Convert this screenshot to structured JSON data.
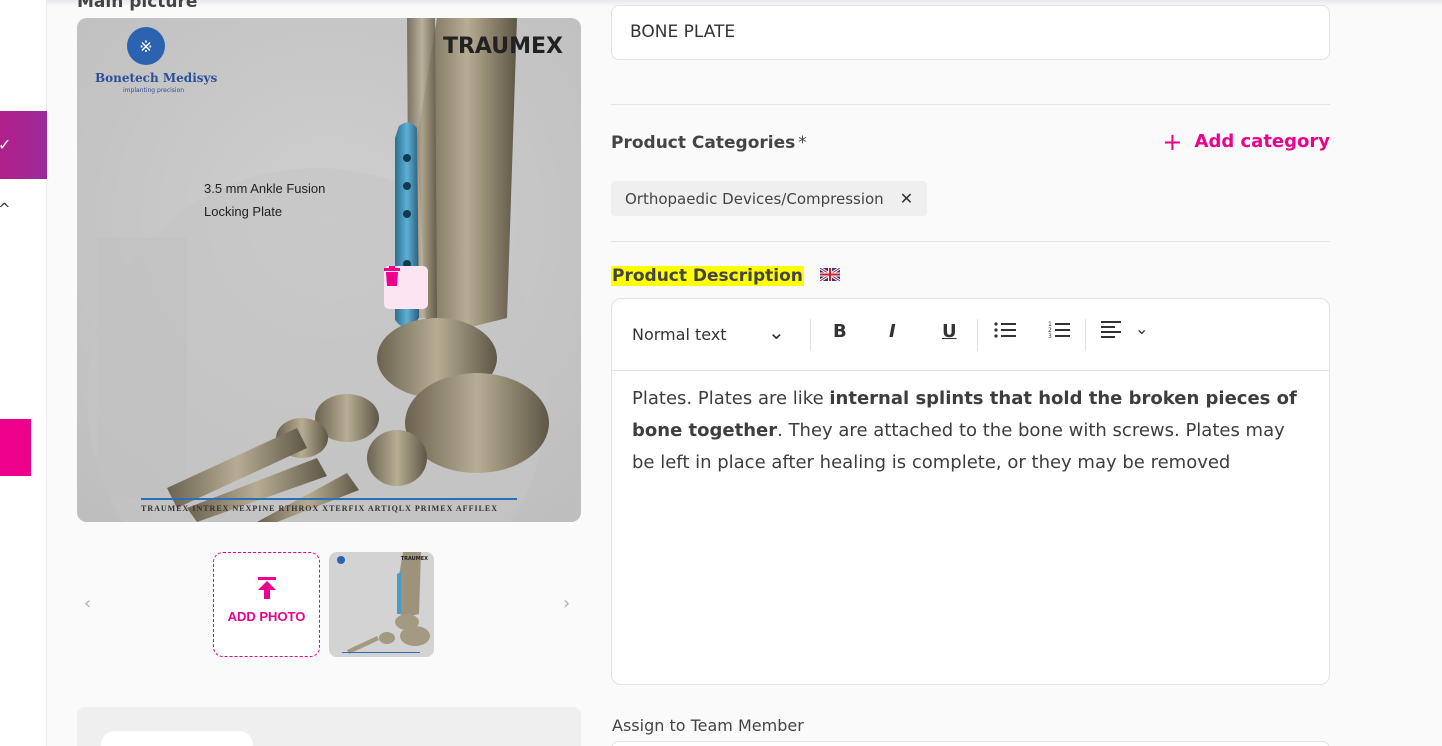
{
  "colors": {
    "accent": "#ec008c",
    "sidebar_active": "#a0259a",
    "highlight": "#ffff00"
  },
  "sidebar": {
    "active_icon": "check-icon",
    "collapse_icon": "chevron-up-icon"
  },
  "main_picture": {
    "label": "Main picture",
    "image": {
      "brand": "Bonetech Medisys",
      "tagline": "implanting precision",
      "logo_title": "TRAUMEX",
      "caption_line1": "3.5 mm Ankle Fusion",
      "caption_line2": "Locking Plate",
      "footer_brands": "TRAUMEX  INTREX  NEXPINE  RTHROX  XTERFIX  ARTIQLX  PRIMEX  AFFILEX"
    },
    "delete_icon": "trash-icon"
  },
  "gallery": {
    "add_photo_label": "ADD PHOTO",
    "prev_icon": "chevron-left-icon",
    "next_icon": "chevron-right-icon",
    "thumb_title": "TRAUMEX"
  },
  "form": {
    "product_name_value": "BONE PLATE",
    "categories": {
      "title": "Product Categories",
      "required_mark": "*",
      "add_label": "Add category",
      "chips": [
        "Orthopaedic Devices/Compression"
      ]
    },
    "description": {
      "title": "Product Description",
      "flag_icon": "uk-flag-icon",
      "toolbar": {
        "text_style": "Normal text",
        "bold": "B",
        "italic": "I",
        "underline": "U"
      },
      "text_part1": "Plates. Plates are like ",
      "text_bold": "internal splints that hold the broken pieces of bone together",
      "text_part2": ". They are attached to the bone with screws. Plates may be left in place after healing is complete, or they may be removed"
    },
    "assign_label": "Assign to Team Member"
  }
}
